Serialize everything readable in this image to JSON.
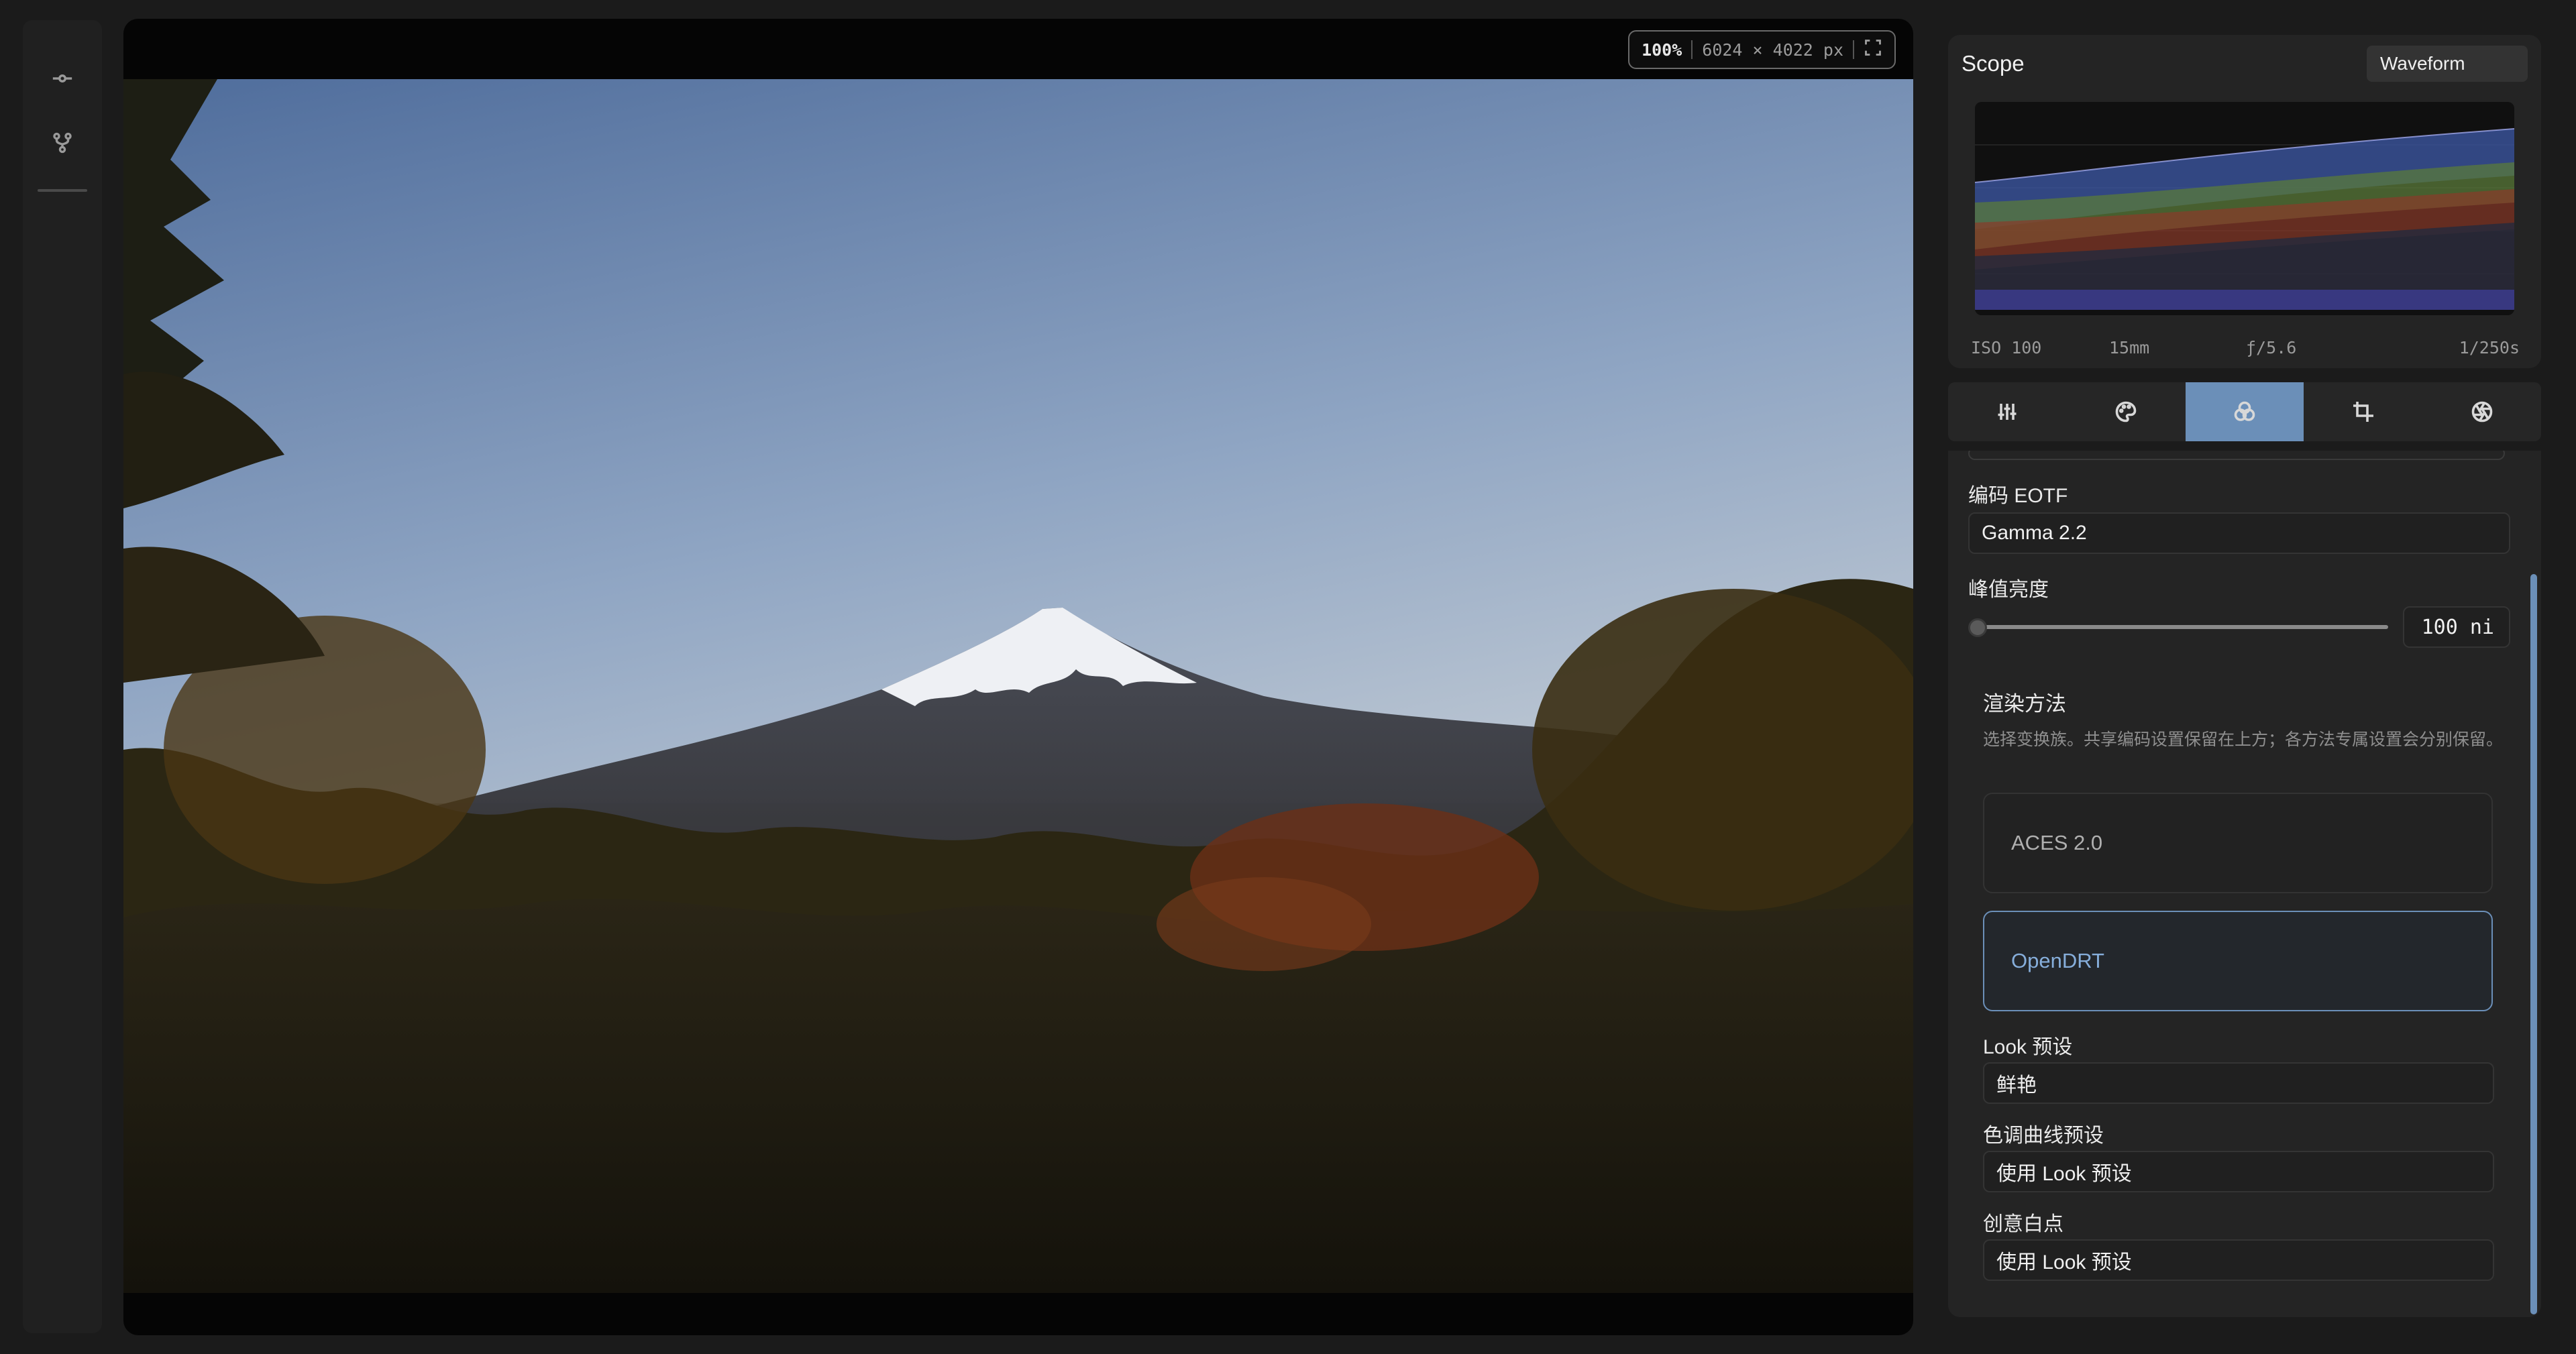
{
  "viewer": {
    "zoom": "100%",
    "dimensions": "6024 × 4022 px",
    "fullscreen_icon": "expand-icon"
  },
  "left_rail": {
    "items": [
      {
        "name": "commit-icon"
      },
      {
        "name": "branch-icon"
      }
    ]
  },
  "scope": {
    "title": "Scope",
    "mode": "Waveform",
    "exif": {
      "iso": "ISO 100",
      "focal": "15mm",
      "aperture": "ƒ/5.6",
      "shutter": "1/250s"
    }
  },
  "tabs": [
    {
      "icon": "sliders-icon",
      "active": false
    },
    {
      "icon": "palette-icon",
      "active": false
    },
    {
      "icon": "color-circles-icon",
      "active": true
    },
    {
      "icon": "crop-icon",
      "active": false
    },
    {
      "icon": "aperture-icon",
      "active": false
    }
  ],
  "settings": {
    "eotf_label": "编码 EOTF",
    "eotf_value": "Gamma 2.2",
    "peak_label": "峰值亮度",
    "peak_value": "100 ni",
    "peak_level": 0.0,
    "render_title": "渲染方法",
    "render_desc": "选择变换族。共享编码设置保留在上方；各方法专属设置会分别保留。",
    "methods": [
      {
        "label": "ACES 2.0",
        "active": false
      },
      {
        "label": "OpenDRT",
        "active": true
      }
    ],
    "look_label": "Look 预设",
    "look_value": "鲜艳",
    "tone_label": "色调曲线预设",
    "tone_value": "使用 Look 预设",
    "wp_label": "创意白点",
    "wp_value": "使用 Look 预设"
  },
  "colors": {
    "accent": "#6b8fb8",
    "background": "#1b1b1b",
    "panel": "#242424"
  }
}
